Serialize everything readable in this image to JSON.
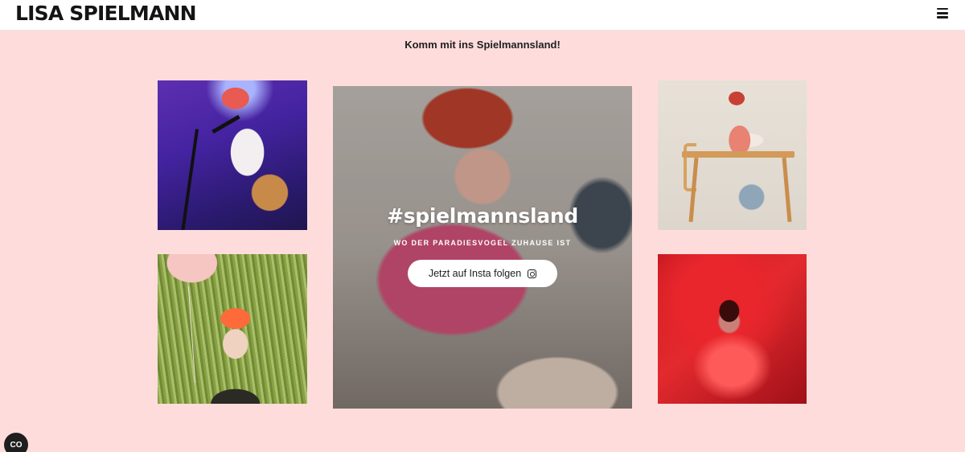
{
  "header": {
    "logo": "LISA SPIELMANN",
    "menu_icon": "hamburger-menu-icon"
  },
  "main": {
    "tagline": "Komm mit ins Spielmannsland!",
    "feature": {
      "title": "#spielmannsland",
      "subtitle": "WO DER PARADIESVOGEL ZUHAUSE IST",
      "button_label": "Jetzt auf Insta folgen",
      "button_icon": "instagram-icon"
    }
  },
  "cookie": {
    "label": "CO",
    "icon": "cookie-consent-icon"
  },
  "colors": {
    "background": "#ffdcdc",
    "header_bg": "#ffffff",
    "text": "#1f1f1f"
  }
}
